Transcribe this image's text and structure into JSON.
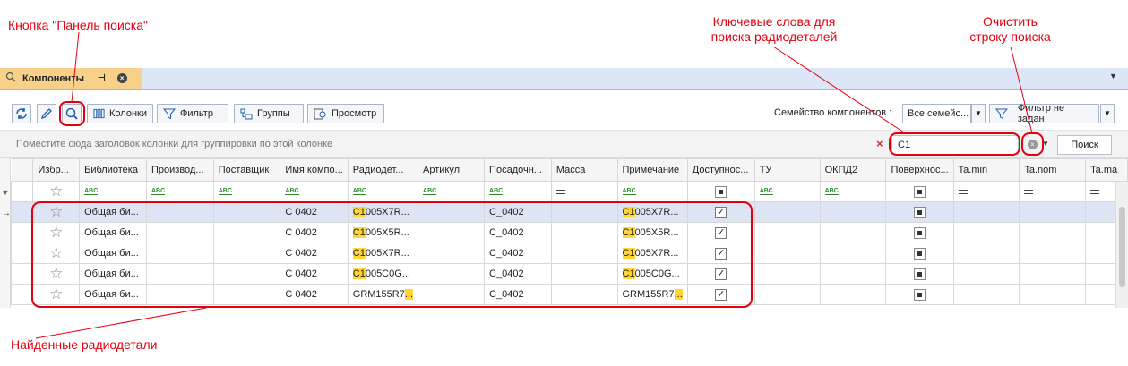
{
  "annotations": {
    "search_panel_button": "Кнопка \"Панель поиска\"",
    "keywords_line1": "Ключевые слова для",
    "keywords_line2": "поиска радиодеталей",
    "clear_line1": "Очистить",
    "clear_line2": "строку поиска",
    "found": "Найденные радиодетали"
  },
  "tab": {
    "title": "Компоненты"
  },
  "toolbar": {
    "columns_label": "Колонки",
    "filter_label": "Фильтр",
    "groups_label": "Группы",
    "preview_label": "Просмотр",
    "family_label": "Семейство компонентов :",
    "family_value": "Все семейс...",
    "filter_status": "Фильтр не задан"
  },
  "group_panel": {
    "hint": "Поместите сюда заголовок колонки для группировки по этой колонке"
  },
  "search": {
    "value": "C1",
    "button_label": "Поиск"
  },
  "columns": [
    "Избр...",
    "Библиотека",
    "Производ...",
    "Поставщик",
    "Имя компо...",
    "Радиодет...",
    "Артикул",
    "Посадочн...",
    "Масса",
    "Примечание",
    "Доступнос...",
    "ТУ",
    "ОКПД2",
    "Поверхнос...",
    "Ta.min",
    "Ta.nom",
    "Ta.ma"
  ],
  "rows": [
    {
      "library": "Общая би...",
      "name": "C 0402",
      "part_hl": "C1",
      "part_rest": "005X7R...",
      "footprint": "C_0402",
      "note_hl": "C1",
      "note_rest": "005X7R..."
    },
    {
      "library": "Общая би...",
      "name": "C 0402",
      "part_hl": "C1",
      "part_rest": "005X5R...",
      "footprint": "C_0402",
      "note_hl": "C1",
      "note_rest": "005X5R..."
    },
    {
      "library": "Общая би...",
      "name": "C 0402",
      "part_hl": "C1",
      "part_rest": "005X7R...",
      "footprint": "C_0402",
      "note_hl": "C1",
      "note_rest": "005X7R..."
    },
    {
      "library": "Общая би...",
      "name": "C 0402",
      "part_hl": "C1",
      "part_rest": "005C0G...",
      "footprint": "C_0402",
      "note_hl": "C1",
      "note_rest": "005C0G..."
    },
    {
      "library": "Общая би...",
      "name": "C 0402",
      "part_pre": "GRM155R7",
      "part_hl": "...",
      "footprint": "C_0402",
      "note_pre": "GRM155R7",
      "note_hl": "..."
    }
  ],
  "colors": {
    "annotation": "#e4000f",
    "highlight": "#ffd633",
    "tab_active": "#f7d189",
    "tab_strip": "#dde6f6",
    "selected_row": "#dde4f4"
  }
}
